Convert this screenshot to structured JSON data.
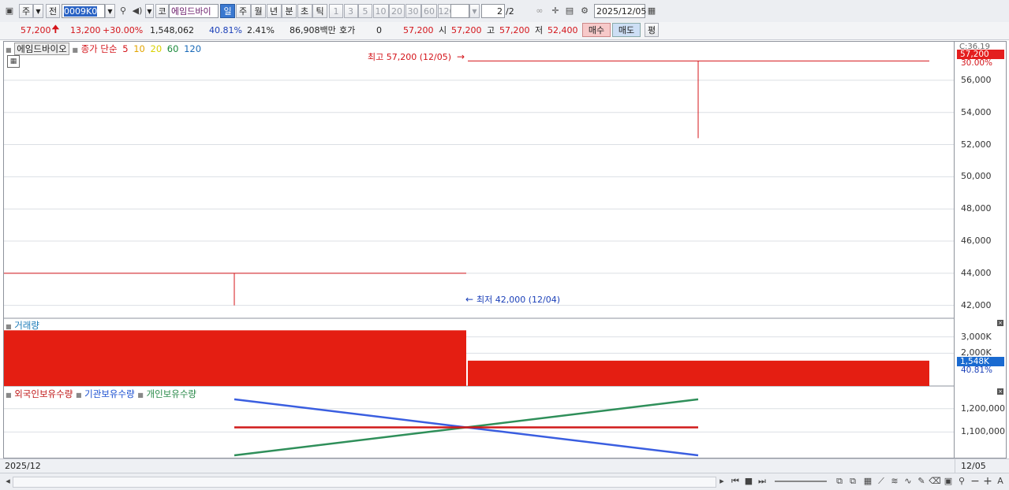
{
  "toolbar": {
    "market_btn": "주",
    "all_btn": "전",
    "code": "0009K0",
    "mode_btn": "코",
    "stock_name": "에임드바이",
    "periods": [
      "일",
      "주",
      "월",
      "년",
      "분",
      "초",
      "틱"
    ],
    "selected_period": "일",
    "intervals": [
      "1",
      "3",
      "5",
      "10",
      "20",
      "30",
      "60",
      "120"
    ],
    "page_current": "2",
    "page_total": "/2",
    "date": "2025/12/05"
  },
  "quote": {
    "price": "57,200",
    "change": "13,200",
    "change_pct": "+30.00%",
    "volume": "1,548,062",
    "ratio1": "40.81%",
    "ratio2": "2.41%",
    "amount": "86,908백만",
    "hoga_label": "호가",
    "hoga_value": "0",
    "hoga_price": "57,200",
    "open_label": "시",
    "open": "57,200",
    "high_label": "고",
    "high": "57,200",
    "low_label": "저",
    "low": "52,400",
    "buy_btn": "매수",
    "sell_btn": "매도",
    "eval_btn": "평"
  },
  "price_panel": {
    "legend_name": "에임드바이오",
    "legend_type": "종가 단순",
    "ma": [
      {
        "label": "5",
        "color": "#d4141a"
      },
      {
        "label": "10",
        "color": "#e2a400"
      },
      {
        "label": "20",
        "color": "#d9d200"
      },
      {
        "label": "60",
        "color": "#1a8a3a"
      },
      {
        "label": "120",
        "color": "#1a6ab8"
      }
    ],
    "high_note": "최고 57,200 (12/05)",
    "low_note": "최저 42,000 (12/04)",
    "axis_top_note": "C:36.19",
    "current_price_tag": "57,200",
    "current_pct": "30.00%",
    "ticks": [
      "56,000",
      "54,000",
      "52,000",
      "50,000",
      "48,000",
      "46,000",
      "44,000",
      "42,000"
    ]
  },
  "volume_panel": {
    "title": "거래량",
    "ticks": [
      "3,000K",
      "2,000K"
    ],
    "current_tag": "1,548K",
    "current_pct": "40.81%"
  },
  "holding_panel": {
    "legend": [
      {
        "label": "외국인보유수량",
        "color": "#c01818"
      },
      {
        "label": "기관보유수량",
        "color": "#1a4fd0"
      },
      {
        "label": "개인보유수량",
        "color": "#2a8a4a"
      }
    ],
    "ticks": [
      "1,200,000",
      "1,100,000"
    ]
  },
  "date_axis": {
    "left": "2025/12",
    "right": "12/05"
  },
  "chart_data": {
    "type": "line",
    "candles": [
      {
        "date": "12/04",
        "open": 44000,
        "high": 44000,
        "low": 42000,
        "close": 44000
      },
      {
        "date": "12/05",
        "open": 57200,
        "high": 57200,
        "low": 52400,
        "close": 57200
      }
    ],
    "volume": [
      3400,
      1548
    ],
    "holdings": {
      "foreign": [
        1120000,
        1120000,
        1120000
      ],
      "institution": [
        1240000,
        1120000,
        1000000
      ],
      "individual": [
        1000000,
        1120000,
        1240000
      ]
    },
    "price_range": [
      41200,
      58200
    ],
    "volume_range": [
      0,
      3800
    ],
    "holding_range": [
      990000,
      1280000
    ]
  }
}
